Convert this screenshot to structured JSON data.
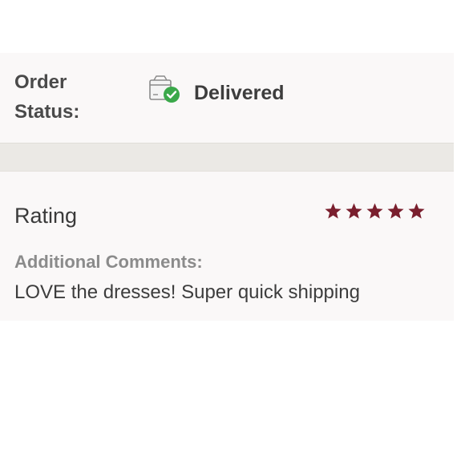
{
  "order": {
    "status_label_line1": "Order",
    "status_label_line2": "Status:",
    "status_value": "Delivered",
    "status_icon": "delivered-package-icon",
    "status_check_color": "#3aa84a"
  },
  "review": {
    "rating_label": "Rating",
    "rating_value": 5,
    "rating_max": 5,
    "star_color": "#7a1f2e",
    "comments_label": "Additional Comments:",
    "comments_text": "LOVE the dresses! Super quick shipping"
  }
}
